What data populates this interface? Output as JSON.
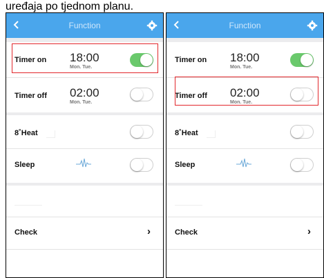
{
  "caption": "uređaja po tjednom planu.",
  "phones": [
    {
      "title": "Function",
      "timer_on": {
        "label": "Timer on",
        "time": "18:00",
        "days": "Mon. Tue.",
        "state": "on"
      },
      "timer_off": {
        "label": "Timer off",
        "time": "02:00",
        "days": "Mon. Tue.",
        "state": "off"
      },
      "heat": {
        "label": "8˚Heat",
        "state": "off"
      },
      "sleep": {
        "label": "Sleep",
        "state": "off"
      },
      "check": {
        "label": "Check"
      },
      "highlight": "timer_on"
    },
    {
      "title": "Function",
      "timer_on": {
        "label": "Timer on",
        "time": "18:00",
        "days": "Mon. Tue.",
        "state": "on"
      },
      "timer_off": {
        "label": "Timer off",
        "time": "02:00",
        "days": "Mon. Tue.",
        "state": "off"
      },
      "heat": {
        "label": "8˚Heat",
        "state": "off"
      },
      "sleep": {
        "label": "Sleep",
        "state": "off"
      },
      "check": {
        "label": "Check"
      },
      "highlight": "timer_off"
    }
  ],
  "colors": {
    "topbar": "#4aa6ec",
    "toggle_on": "#6ac96c",
    "highlight": "#e2262b",
    "background": "#ececee"
  },
  "icons": [
    "back-arrow-icon",
    "gear-icon",
    "sleep-wave-icon",
    "chevron-right-icon"
  ]
}
